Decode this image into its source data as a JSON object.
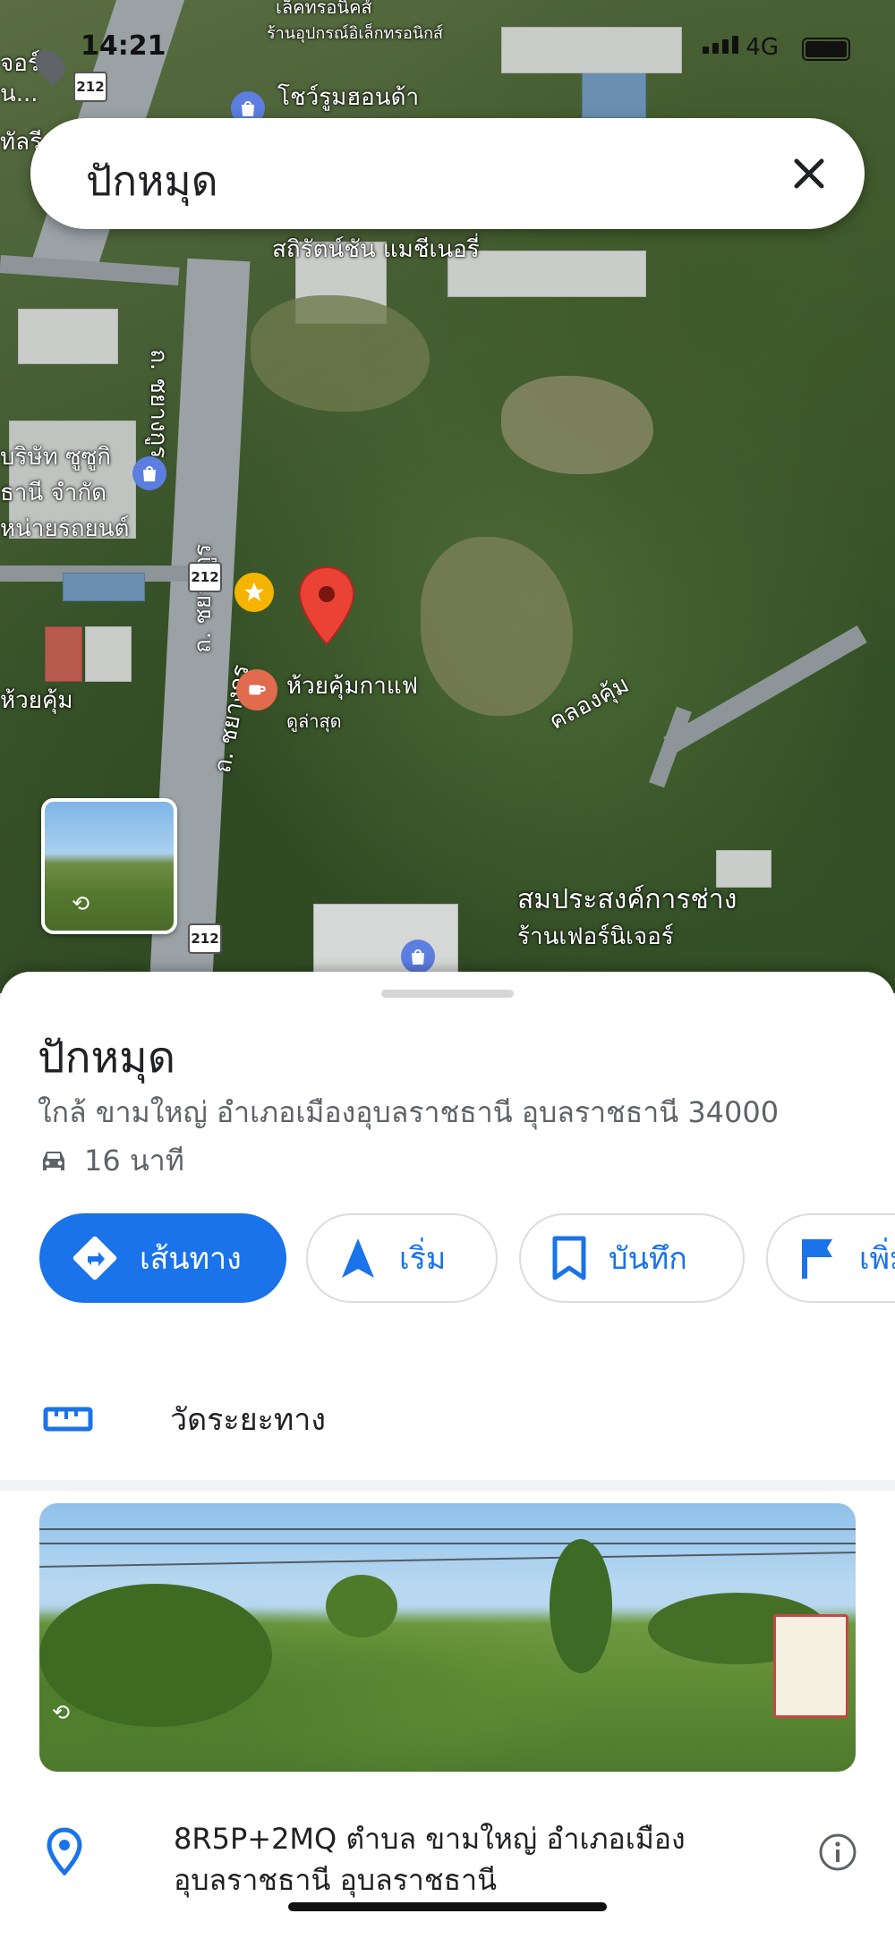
{
  "status": {
    "time": "14:21",
    "network": "4G"
  },
  "search": {
    "query": "ปักหมุด"
  },
  "map": {
    "labels": {
      "electronics": "เล็คทรอนิคส์",
      "electronics_shop": "ร้านอุปกรณ์อิเล็กทรอนิกส์",
      "showroom": "โชว์รูมฮอนด้า",
      "sattacha": "สถิรัตน์ชัน แมชีเนอรี่",
      "suzuki_line1": "บริษัท ซูซูกิ",
      "suzuki_line2": "ธานี จำกัด",
      "suzuki_line3": "หน่ายรถยนต์",
      "road_left1": "ถ. ชยางกูร",
      "road_left2": "ถ. ชยางกูร",
      "road_left3": "ถ. ชยางกูร",
      "cafe": "ห้วยคุ้มกาแฟ",
      "cafe_sub": "ดูล่าสุด",
      "canal": "คลองคุ้ม",
      "huay_kum": "ห้วยคุ้ม",
      "sompra_line1": "สมประสงค์การช่าง",
      "sompra_line2": "ร้านเฟอร์นิเจอร์",
      "left_top1": "จอร์",
      "left_top2": "น...",
      "left_top3": "ทัลรี"
    },
    "route_shield": "212"
  },
  "place": {
    "title": "ปักหมุด",
    "address": "ใกล้ ขามใหญ่ อำเภอเมืองอุบลราชธานี อุบลราชธานี 34000",
    "drive_time": "16 นาที"
  },
  "actions": {
    "directions": "เส้นทาง",
    "start": "เริ่ม",
    "save": "บันทึก",
    "flag": "เพิ่ม"
  },
  "measure": {
    "label": "วัดระยะทาง"
  },
  "plus_code": {
    "line1": "8R5P+2MQ ตำบล ขามใหญ่ อำเภอเมือง",
    "line2": "อุบลราชธานี อุบลราชธานี"
  },
  "colors": {
    "accent": "#1a73e8",
    "pin": "#ea4335"
  }
}
